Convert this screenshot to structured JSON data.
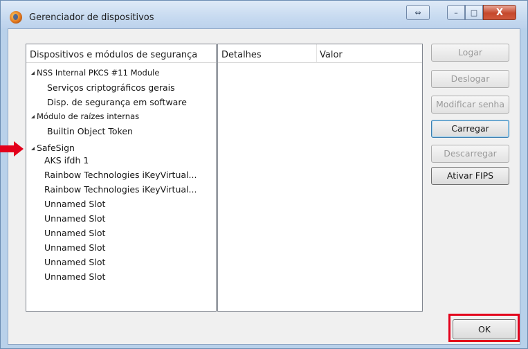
{
  "window": {
    "title": "Gerenciador de dispositivos",
    "caption_resize_glyph": "⇔",
    "caption_min_glyph": "–",
    "caption_max_glyph": "□",
    "caption_close_glyph": "X"
  },
  "tree": {
    "header": "Dispositivos e módulos de segurança",
    "items": [
      {
        "label": "NSS Internal PKCS #11 Module",
        "level": 0,
        "expanded": true
      },
      {
        "label": "Serviços criptográficos gerais",
        "level": 1
      },
      {
        "label": "Disp. de segurança em software",
        "level": 1
      },
      {
        "label": "Módulo de raízes internas",
        "level": 0,
        "expanded": true
      },
      {
        "label": "Builtin Object Token",
        "level": 1
      },
      {
        "label": "SafeSign",
        "level": 0,
        "expanded": true
      },
      {
        "label": "AKS ifdh 1",
        "level": 1
      },
      {
        "label": "Rainbow Technologies iKeyVirtual...",
        "level": 1
      },
      {
        "label": "Rainbow Technologies iKeyVirtual...",
        "level": 1
      },
      {
        "label": "Unnamed Slot",
        "level": 1
      },
      {
        "label": "Unnamed Slot",
        "level": 1
      },
      {
        "label": "Unnamed Slot",
        "level": 1
      },
      {
        "label": "Unnamed Slot",
        "level": 1
      },
      {
        "label": "Unnamed Slot",
        "level": 1
      },
      {
        "label": "Unnamed Slot",
        "level": 1
      }
    ]
  },
  "details": {
    "col_detalhes": "Detalhes",
    "col_valor": "Valor"
  },
  "buttons": {
    "logar": {
      "label": "Logar",
      "enabled": false
    },
    "deslogar": {
      "label": "Deslogar",
      "enabled": false
    },
    "modificar_senha": {
      "label": "Modificar senha",
      "enabled": false
    },
    "carregar": {
      "label": "Carregar",
      "enabled": true
    },
    "descarregar": {
      "label": "Descarregar",
      "enabled": false
    },
    "ativar_fips": {
      "label": "Ativar FIPS",
      "enabled": true
    },
    "ok": {
      "label": "OK",
      "enabled": true
    }
  },
  "annotation_colors": {
    "arrow": "#e3001b",
    "highlight_box": "#e3001b"
  }
}
